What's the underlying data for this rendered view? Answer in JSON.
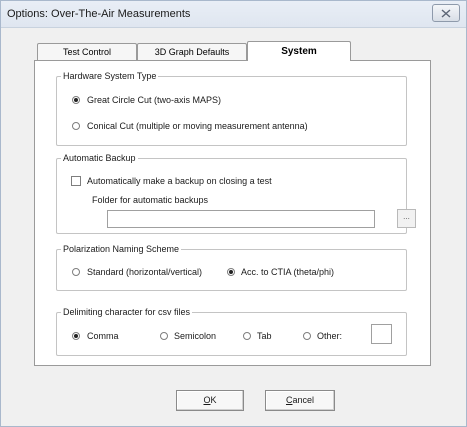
{
  "window": {
    "title": "Options: Over-The-Air Measurements"
  },
  "tabs": [
    {
      "label": "Test Control",
      "selected": false
    },
    {
      "label": "3D Graph Defaults",
      "selected": false
    },
    {
      "label": "System",
      "selected": true
    }
  ],
  "hardware": {
    "legend": "Hardware System Type",
    "options": [
      {
        "label": "Great Circle Cut (two-axis MAPS)",
        "checked": true
      },
      {
        "label": "Conical Cut (multiple or moving measurement antenna)",
        "checked": false
      }
    ]
  },
  "backup": {
    "legend": "Automatic Backup",
    "checkbox_label": "Automatically make a backup on closing a test",
    "checked": false,
    "folder_label": "Folder for automatic backups",
    "folder_value": "",
    "browse_label": "..."
  },
  "polarization": {
    "legend": "Polarization Naming Scheme",
    "options": [
      {
        "label": "Standard (horizontal/vertical)",
        "checked": false
      },
      {
        "label": "Acc. to CTIA (theta/phi)",
        "checked": true
      }
    ]
  },
  "delimiter": {
    "legend": "Delimiting character for csv files",
    "options": [
      {
        "label": "Comma",
        "checked": true
      },
      {
        "label": "Semicolon",
        "checked": false
      },
      {
        "label": "Tab",
        "checked": false
      },
      {
        "label": "Other:",
        "checked": false
      }
    ],
    "other_value": ""
  },
  "buttons": {
    "ok_mnemonic": "O",
    "ok_rest": "K",
    "cancel_mnemonic": "C",
    "cancel_rest": "ancel"
  },
  "icons": {
    "close": "close-icon"
  }
}
